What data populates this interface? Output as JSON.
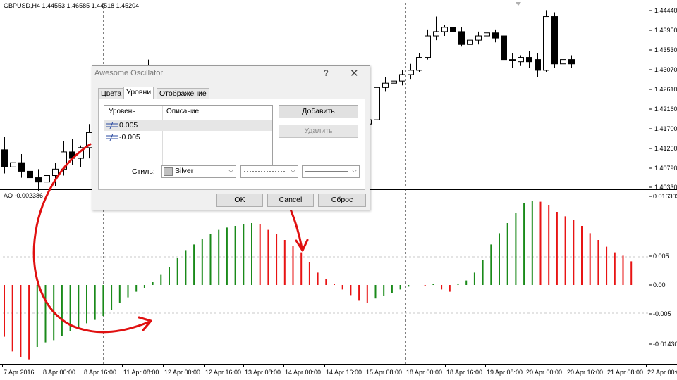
{
  "chart": {
    "symbol_info": "GBPUSD,H4  1.44553 1.46585 1.44518 1.45204",
    "indicator_info": "AO -0.002386",
    "price_axis": [
      "1.44440",
      "1.43950",
      "1.43530",
      "1.43070",
      "1.42610",
      "1.42160",
      "1.41700",
      "1.41250",
      "1.40790",
      "1.40330"
    ],
    "ao_axis": [
      "0.016302",
      "0.005",
      "0.00",
      "-0.005",
      "-0.014306"
    ],
    "time_axis": [
      "7 Apr 2016",
      "8 Apr 00:00",
      "8 Apr 16:00",
      "11 Apr 08:00",
      "12 Apr 00:00",
      "12 Apr 16:00",
      "13 Apr 08:00",
      "14 Apr 00:00",
      "14 Apr 16:00",
      "15 Apr 08:00",
      "18 Apr 00:00",
      "18 Apr 16:00",
      "19 Apr 08:00",
      "20 Apr 00:00",
      "20 Apr 16:00",
      "21 Apr 08:00",
      "22 Apr 00:00"
    ],
    "colors": {
      "ao_up": "#1a8a1a",
      "ao_down": "#e81414",
      "arrow": "#e01010",
      "grid": "#c8c8c8"
    },
    "candles": [
      {
        "o": 1.412,
        "h": 1.415,
        "l": 1.4065,
        "c": 1.408
      },
      {
        "o": 1.408,
        "h": 1.414,
        "l": 1.404,
        "c": 1.409
      },
      {
        "o": 1.409,
        "h": 1.411,
        "l": 1.4055,
        "c": 1.407
      },
      {
        "o": 1.407,
        "h": 1.41,
        "l": 1.404,
        "c": 1.4055
      },
      {
        "o": 1.4055,
        "h": 1.4075,
        "l": 1.4025,
        "c": 1.4045
      },
      {
        "o": 1.4045,
        "h": 1.407,
        "l": 1.403,
        "c": 1.406
      },
      {
        "o": 1.406,
        "h": 1.409,
        "l": 1.4035,
        "c": 1.4075
      },
      {
        "o": 1.4075,
        "h": 1.414,
        "l": 1.406,
        "c": 1.4115
      },
      {
        "o": 1.4115,
        "h": 1.4145,
        "l": 1.4085,
        "c": 1.41
      },
      {
        "o": 1.41,
        "h": 1.413,
        "l": 1.408,
        "c": 1.4125
      },
      {
        "o": 1.4125,
        "h": 1.418,
        "l": 1.41,
        "c": 1.416
      },
      {
        "o": 1.416,
        "h": 1.4205,
        "l": 1.414,
        "c": 1.4185
      },
      {
        "o": 1.4185,
        "h": 1.4245,
        "l": 1.416,
        "c": 1.423
      },
      {
        "o": 1.423,
        "h": 1.427,
        "l": 1.42,
        "c": 1.4255
      },
      {
        "o": 1.4255,
        "h": 1.429,
        "l": 1.4225,
        "c": 1.427
      },
      {
        "o": 1.427,
        "h": 1.431,
        "l": 1.424,
        "c": 1.4285
      },
      {
        "o": 1.4285,
        "h": 1.432,
        "l": 1.425,
        "c": 1.43
      },
      {
        "o": 1.43,
        "h": 1.433,
        "l": 1.427,
        "c": 1.431
      },
      {
        "o": 1.431,
        "h": 1.4335,
        "l": 1.426,
        "c": 1.429
      },
      {
        "o": 1.429,
        "h": 1.43,
        "l": 1.422,
        "c": 1.424
      },
      {
        "o": 1.424,
        "h": 1.4265,
        "l": 1.4185,
        "c": 1.42
      },
      {
        "o": 1.42,
        "h": 1.423,
        "l": 1.416,
        "c": 1.4175
      },
      {
        "o": 1.4175,
        "h": 1.42,
        "l": 1.413,
        "c": 1.4155
      },
      {
        "o": 1.4155,
        "h": 1.4185,
        "l": 1.412,
        "c": 1.415
      },
      {
        "o": 1.415,
        "h": 1.4175,
        "l": 1.413,
        "c": 1.416
      },
      {
        "o": 1.416,
        "h": 1.42,
        "l": 1.414,
        "c": 1.4185
      },
      {
        "o": 1.4185,
        "h": 1.4215,
        "l": 1.415,
        "c": 1.417
      },
      {
        "o": 1.414,
        "h": 1.4225,
        "l": 1.4135,
        "c": 1.4205
      },
      {
        "o": 1.4205,
        "h": 1.423,
        "l": 1.416,
        "c": 1.4165
      },
      {
        "o": 1.4165,
        "h": 1.422,
        "l": 1.4145,
        "c": 1.42
      },
      {
        "o": 1.42,
        "h": 1.4235,
        "l": 1.4175,
        "c": 1.4185
      },
      {
        "o": 1.4185,
        "h": 1.42,
        "l": 1.416,
        "c": 1.417
      },
      {
        "o": 1.417,
        "h": 1.418,
        "l": 1.4155,
        "c": 1.4165
      },
      {
        "o": 1.4165,
        "h": 1.4195,
        "l": 1.4135,
        "c": 1.418
      },
      {
        "o": 1.418,
        "h": 1.42,
        "l": 1.413,
        "c": 1.4165
      },
      {
        "o": 1.4165,
        "h": 1.4195,
        "l": 1.414,
        "c": 1.418
      },
      {
        "o": 1.4145,
        "h": 1.4175,
        "l": 1.4135,
        "c": 1.416
      },
      {
        "o": 1.416,
        "h": 1.424,
        "l": 1.4155,
        "c": 1.4235
      },
      {
        "o": 1.4235,
        "h": 1.425,
        "l": 1.4135,
        "c": 1.4205
      },
      {
        "o": 1.4205,
        "h": 1.4215,
        "l": 1.4165,
        "c": 1.4178
      },
      {
        "o": 1.4178,
        "h": 1.4185,
        "l": 1.416,
        "c": 1.417
      },
      {
        "o": 1.417,
        "h": 1.419,
        "l": 1.414,
        "c": 1.4165
      },
      {
        "o": 1.4165,
        "h": 1.42,
        "l": 1.413,
        "c": 1.418
      },
      {
        "o": 1.418,
        "h": 1.4205,
        "l": 1.416,
        "c": 1.419
      },
      {
        "o": 1.419,
        "h": 1.427,
        "l": 1.4185,
        "c": 1.4265
      },
      {
        "o": 1.4265,
        "h": 1.429,
        "l": 1.4255,
        "c": 1.4275
      },
      {
        "o": 1.4275,
        "h": 1.429,
        "l": 1.426,
        "c": 1.428
      },
      {
        "o": 1.428,
        "h": 1.4305,
        "l": 1.427,
        "c": 1.4295
      },
      {
        "o": 1.4295,
        "h": 1.432,
        "l": 1.4285,
        "c": 1.4305
      },
      {
        "o": 1.4305,
        "h": 1.4345,
        "l": 1.43,
        "c": 1.4335
      },
      {
        "o": 1.4335,
        "h": 1.44,
        "l": 1.433,
        "c": 1.4385
      },
      {
        "o": 1.4385,
        "h": 1.443,
        "l": 1.4375,
        "c": 1.4395
      },
      {
        "o": 1.4395,
        "h": 1.441,
        "l": 1.4385,
        "c": 1.4405
      },
      {
        "o": 1.4405,
        "h": 1.441,
        "l": 1.439,
        "c": 1.4395
      },
      {
        "o": 1.4395,
        "h": 1.4405,
        "l": 1.436,
        "c": 1.4365
      },
      {
        "o": 1.4365,
        "h": 1.438,
        "l": 1.4345,
        "c": 1.4375
      },
      {
        "o": 1.4375,
        "h": 1.4395,
        "l": 1.4365,
        "c": 1.4385
      },
      {
        "o": 1.4385,
        "h": 1.442,
        "l": 1.4375,
        "c": 1.4392
      },
      {
        "o": 1.4392,
        "h": 1.44,
        "l": 1.437,
        "c": 1.438
      },
      {
        "o": 1.4385,
        "h": 1.4395,
        "l": 1.431,
        "c": 1.433
      },
      {
        "o": 1.433,
        "h": 1.4345,
        "l": 1.431,
        "c": 1.433
      },
      {
        "o": 1.4325,
        "h": 1.434,
        "l": 1.4315,
        "c": 1.4335
      },
      {
        "o": 1.4335,
        "h": 1.435,
        "l": 1.431,
        "c": 1.4325
      },
      {
        "o": 1.433,
        "h": 1.4345,
        "l": 1.429,
        "c": 1.4305
      },
      {
        "o": 1.4305,
        "h": 1.4445,
        "l": 1.43,
        "c": 1.443
      },
      {
        "o": 1.443,
        "h": 1.444,
        "l": 1.431,
        "c": 1.432
      },
      {
        "o": 1.432,
        "h": 1.4335,
        "l": 1.4305,
        "c": 1.433
      },
      {
        "o": 1.433,
        "h": 1.434,
        "l": 1.431,
        "c": 1.432
      }
    ],
    "ao_values": [
      -0.0092,
      -0.0118,
      -0.0128,
      -0.0132,
      -0.011,
      -0.0102,
      -0.0098,
      -0.009,
      -0.0082,
      -0.0075,
      -0.0068,
      -0.0062,
      -0.0055,
      -0.0045,
      -0.0032,
      -0.0022,
      -0.0012,
      -0.0005,
      0.0005,
      0.0018,
      0.0032,
      0.0048,
      0.0062,
      0.0072,
      0.0082,
      0.009,
      0.0098,
      0.0102,
      0.0105,
      0.0108,
      0.011,
      0.0108,
      0.0098,
      0.009,
      0.008,
      0.007,
      0.0058,
      0.004,
      0.0022,
      0.001,
      0.0002,
      -0.0008,
      -0.0018,
      -0.0028,
      -0.0032,
      -0.0024,
      -0.002,
      -0.0015,
      -0.0008,
      -0.0003,
      0.0,
      -0.0002,
      0.0002,
      -0.0008,
      -0.0012,
      0.0002,
      0.0008,
      0.0022,
      0.0045,
      0.0072,
      0.0092,
      0.011,
      0.0128,
      0.0145,
      0.015,
      0.0148,
      0.0142,
      0.013,
      0.0122,
      0.0115,
      0.0105,
      0.0092,
      0.008,
      0.0068,
      0.0058,
      0.0052,
      0.0042
    ],
    "ao_colors": [
      "down",
      "down",
      "down",
      "down",
      "up",
      "up",
      "up",
      "up",
      "up",
      "up",
      "up",
      "up",
      "up",
      "up",
      "up",
      "up",
      "up",
      "up",
      "up",
      "up",
      "up",
      "up",
      "up",
      "up",
      "up",
      "up",
      "up",
      "up",
      "up",
      "up",
      "up",
      "down",
      "down",
      "down",
      "down",
      "down",
      "down",
      "down",
      "down",
      "down",
      "down",
      "down",
      "down",
      "down",
      "down",
      "up",
      "up",
      "up",
      "up",
      "up",
      "up",
      "down",
      "up",
      "down",
      "down",
      "up",
      "up",
      "up",
      "up",
      "up",
      "up",
      "up",
      "up",
      "up",
      "up",
      "down",
      "down",
      "down",
      "down",
      "down",
      "down",
      "down",
      "down",
      "down",
      "down",
      "down",
      "down"
    ]
  },
  "dialog": {
    "title": "Awesome Oscillator",
    "help": "?",
    "close": "✕",
    "tabs": [
      "Цвета",
      "Уровни",
      "Отображение"
    ],
    "active_tab": "Уровни",
    "list_headers": {
      "level": "Уровень",
      "description": "Описание"
    },
    "levels": [
      {
        "value": "0.005",
        "description": ""
      },
      {
        "value": "-0.005",
        "description": ""
      }
    ],
    "add_button": "Добавить",
    "delete_button": "Удалить",
    "style_label": "Стиль:",
    "color_value": "Silver",
    "color_swatch": "#c0c0c0",
    "ok_button": "OK",
    "cancel_button": "Cancel",
    "reset_button": "Сброс"
  }
}
